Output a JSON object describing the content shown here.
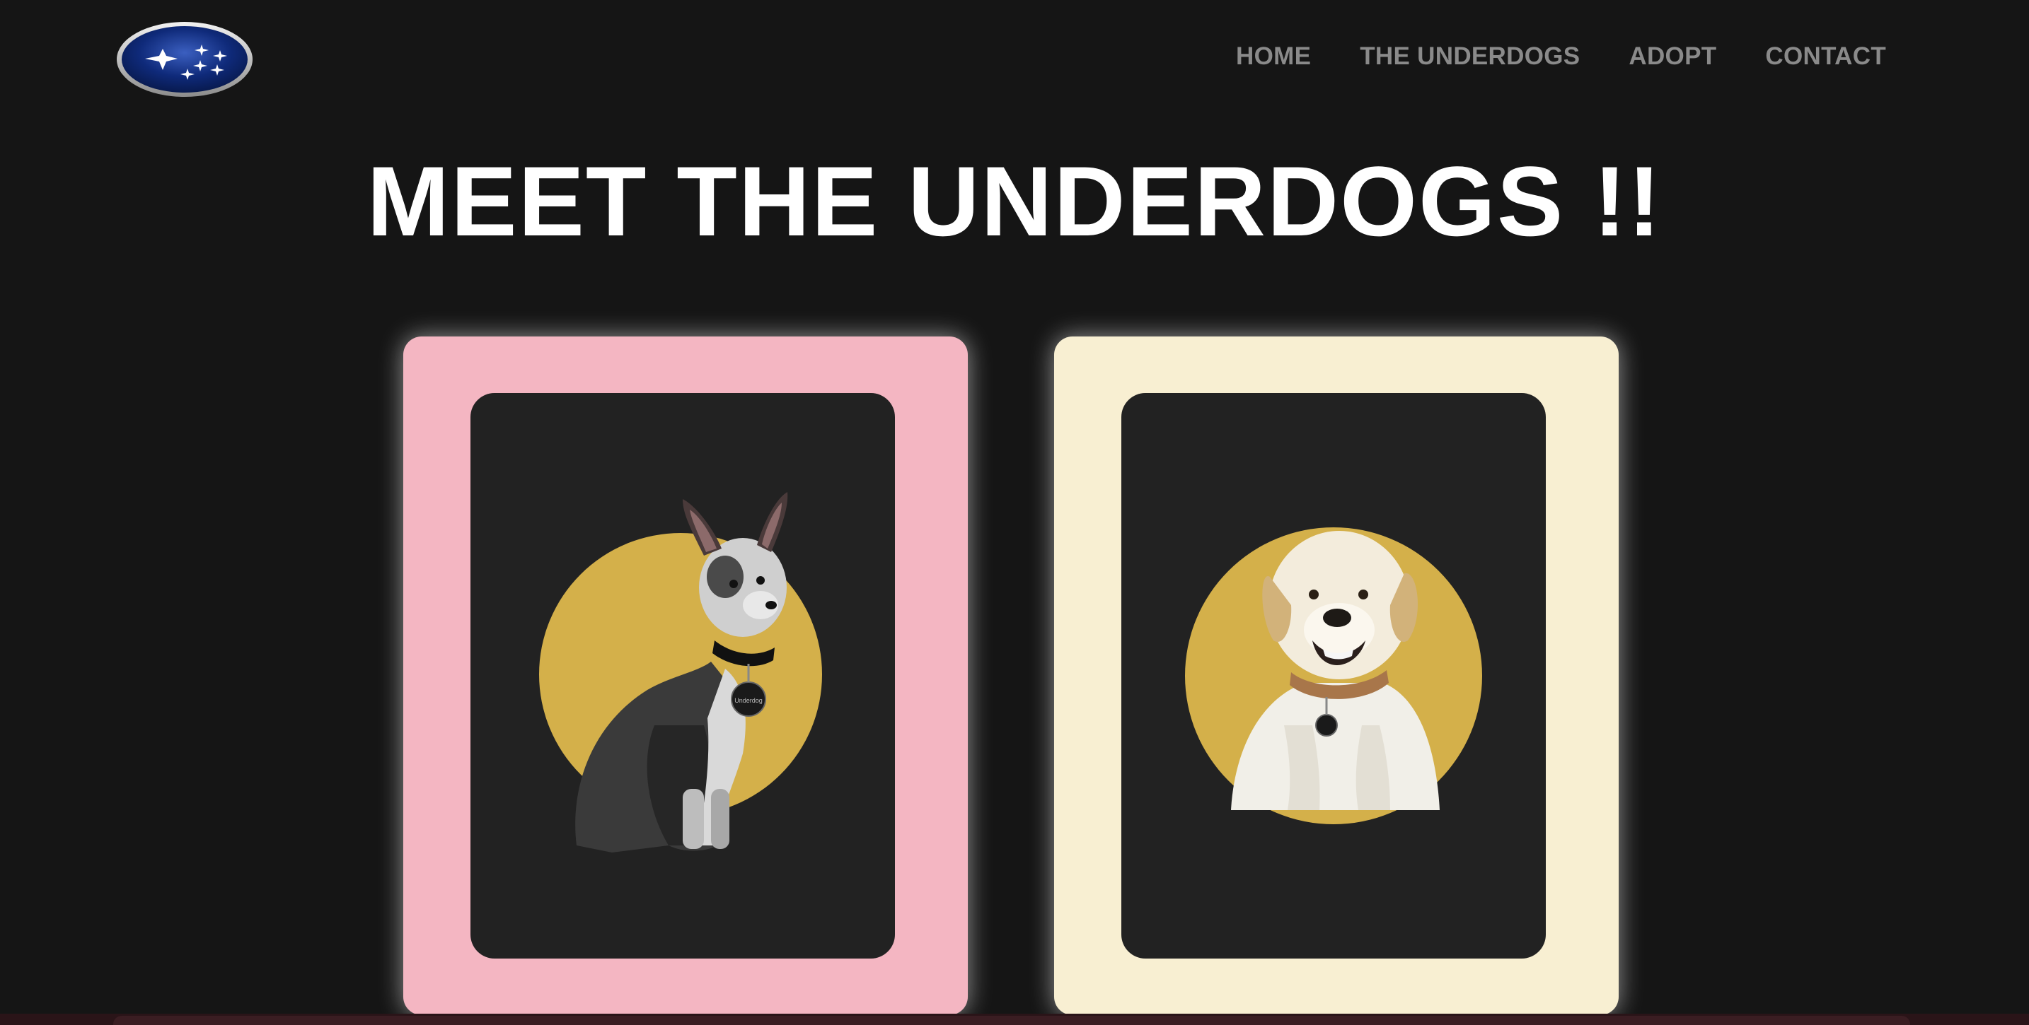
{
  "header": {
    "logo_icon": "subaru-logo",
    "nav": [
      {
        "label": "HOME"
      },
      {
        "label": "THE UNDERDOGS"
      },
      {
        "label": "ADOPT"
      },
      {
        "label": "CONTACT"
      }
    ]
  },
  "main": {
    "title": "MEET THE UNDERDOGS !!",
    "cards": [
      {
        "frame_color": "#f4b6c2",
        "image": "chihuahua-mix-dog-photo",
        "circle_color": "#d4b04a",
        "tag_text": "Underdog"
      },
      {
        "frame_color": "#f8efd2",
        "image": "labrador-dog-photo",
        "circle_color": "#d4b04a",
        "tag_text": ""
      }
    ]
  },
  "colors": {
    "background": "#151515",
    "nav_text": "#8a8a8a",
    "title_text": "#ffffff",
    "card_inner": "#222222"
  }
}
